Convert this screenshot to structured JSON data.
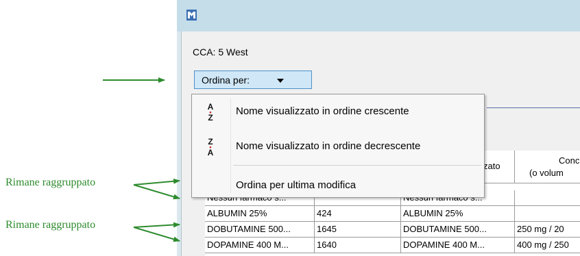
{
  "window": {
    "cca_label": "CCA:",
    "cca_value": "5 West"
  },
  "sort_button": {
    "label": "Ordina per:"
  },
  "sort_menu": {
    "items": [
      {
        "label": "Nome visualizzato in ordine crescente",
        "icon": "sort-az-icon",
        "icon_top": "A",
        "icon_bottom": "Z"
      },
      {
        "label": "Nome visualizzato in ordine decrescente",
        "icon": "sort-za-icon",
        "icon_top": "Z",
        "icon_bottom": "A"
      },
      {
        "label": "Ordina per ultima modifica"
      }
    ]
  },
  "table": {
    "headers": [
      {
        "line1": "",
        "line2": ""
      },
      {
        "line1": "",
        "line2": ""
      },
      {
        "line1": "",
        "line2": "zato"
      },
      {
        "line1": "Conc",
        "line2": "(o volum"
      }
    ],
    "rows": [
      [
        "Nessun farmaco s...",
        "",
        "Nessun farmaco s...",
        ""
      ],
      [
        "ALBUMIN 25%",
        "424",
        "ALBUMIN 25%",
        ""
      ],
      [
        "DOBUTAMINE 500...",
        "1645",
        "DOBUTAMINE 500...",
        "250 mg / 20"
      ],
      [
        "DOPAMINE 400 M...",
        "1640",
        "DOPAMINE 400 M...",
        "400 mg / 250"
      ]
    ]
  },
  "annotations": {
    "note1": "Rimane raggruppato",
    "note2": "Rimane raggruppato"
  },
  "colors": {
    "arrow": "#2e8b2e",
    "button_bg": "#cfe7f7",
    "titlebar": "#c4dde9"
  }
}
